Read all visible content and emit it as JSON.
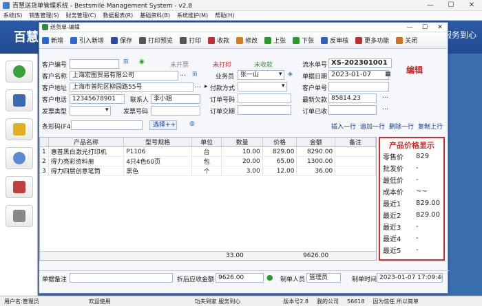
{
  "outer": {
    "title": "百慧送货单管理系统 - Bestsmile Management System - v2.8",
    "menu": [
      "系统(S)",
      "销售管理(S)",
      "财务管理(C)",
      "数据报表(R)",
      "基础资料(B)",
      "系统维护(M)",
      "帮助(H)"
    ],
    "brand": "百慧",
    "slogan": "专业 专注 · 服务到心"
  },
  "dialog": {
    "title": "送货单-编辑",
    "win_controls": [
      "—",
      "☐",
      "✕"
    ],
    "toolbar": [
      {
        "label": "新增",
        "color": "#2a6ad0"
      },
      {
        "label": "引入新增",
        "color": "#2a6ad0"
      },
      {
        "label": "保存",
        "color": "#2a4a9a"
      },
      {
        "label": "打印预览",
        "color": "#555"
      },
      {
        "label": "打印",
        "color": "#555"
      },
      {
        "label": "收款",
        "color": "#c03030"
      },
      {
        "label": "修改",
        "color": "#d08020"
      },
      {
        "label": "上张",
        "color": "#2a9a2a"
      },
      {
        "label": "下张",
        "color": "#2a9a2a"
      },
      {
        "label": "反审核",
        "color": "#3060c0"
      },
      {
        "label": "更多功能",
        "color": "#c03030"
      },
      {
        "label": "关闭",
        "color": "#d07020"
      }
    ]
  },
  "form": {
    "customer_code_label": "客户编号",
    "customer_code": "",
    "unbilled": "未开票",
    "unprinted": "未打印",
    "unpaid": "未收款",
    "order_no_label": "流水单号",
    "order_no": "XS-202301001",
    "edit_status": "编辑",
    "customer_name_label": "客户名称",
    "customer_name": "上海宏图贸易有限公司",
    "salesman_label": "业务员",
    "salesman": "张一山",
    "date_label": "单据日期",
    "date": "2023-01-07",
    "address_label": "客户地址",
    "address": "上海市普陀区柳园路55号",
    "pay_method_label": "付款方式",
    "pay_method": "",
    "cust_order_label": "客户单号",
    "cust_order": "",
    "phone_label": "客户电话",
    "phone": "12345678901",
    "contact_label": "联系人",
    "contact": "李小姐",
    "order_num_label": "订单号码",
    "order_num": "",
    "debt_label": "最新欠款",
    "debt": "85814.23",
    "invoice_type_label": "发票类型",
    "invoice_type": "",
    "invoice_no_label": "发票号码",
    "invoice_no": "",
    "delivery_label": "订单交期",
    "delivery": "",
    "collected_label": "订单已收",
    "collected": "",
    "barcode_label": "条形码(F4)",
    "barcode": "",
    "select_btn": "选择++",
    "row_actions": [
      "插入一行",
      "追加一行",
      "删除一行",
      "复制上行"
    ]
  },
  "grid": {
    "headers": [
      "",
      "产品名称",
      "型号规格",
      "单位",
      "数量",
      "价格",
      "金额",
      "备注"
    ],
    "rows": [
      [
        "1",
        "惠普黑白激光打印机",
        "P1106",
        "台",
        "10.00",
        "829.00",
        "8290.00",
        ""
      ],
      [
        "2",
        "得力亮彩资料册",
        "4只4色60页",
        "包",
        "20.00",
        "65.00",
        "1300.00",
        ""
      ],
      [
        "3",
        "得力四层创意笔筒",
        "黑色",
        "个",
        "3.00",
        "12.00",
        "36.00",
        ""
      ]
    ],
    "total_qty": "33.00",
    "total_amount": "9626.00"
  },
  "price_panel": {
    "title": "产品价格显示",
    "rows": [
      {
        "k": "零售价",
        "v": "829"
      },
      {
        "k": "批发价",
        "v": "-"
      },
      {
        "k": "最低价",
        "v": "-"
      },
      {
        "k": "成本价",
        "v": "~~"
      },
      {
        "k": "最近1",
        "v": "829.00"
      },
      {
        "k": "最近2",
        "v": "829.00"
      },
      {
        "k": "最近3",
        "v": "-"
      },
      {
        "k": "最近4",
        "v": "-"
      },
      {
        "k": "最近5",
        "v": "-"
      }
    ]
  },
  "bottom": {
    "remark_label": "单据备注",
    "remark": "",
    "net_label": "折后应收金额",
    "net": "9626.00",
    "creator_label": "制单人员",
    "creator": "管理员",
    "time_label": "制单时间",
    "time": "2023-01-07 17:09:40"
  },
  "status": {
    "user": "用户名:管理员",
    "welcome": "欢迎使用",
    "slogan": "功夫到家 服务到心",
    "version": "版本号2.8",
    "company": "我的公司",
    "num": "56618",
    "note": "因为信任 所以简单"
  }
}
